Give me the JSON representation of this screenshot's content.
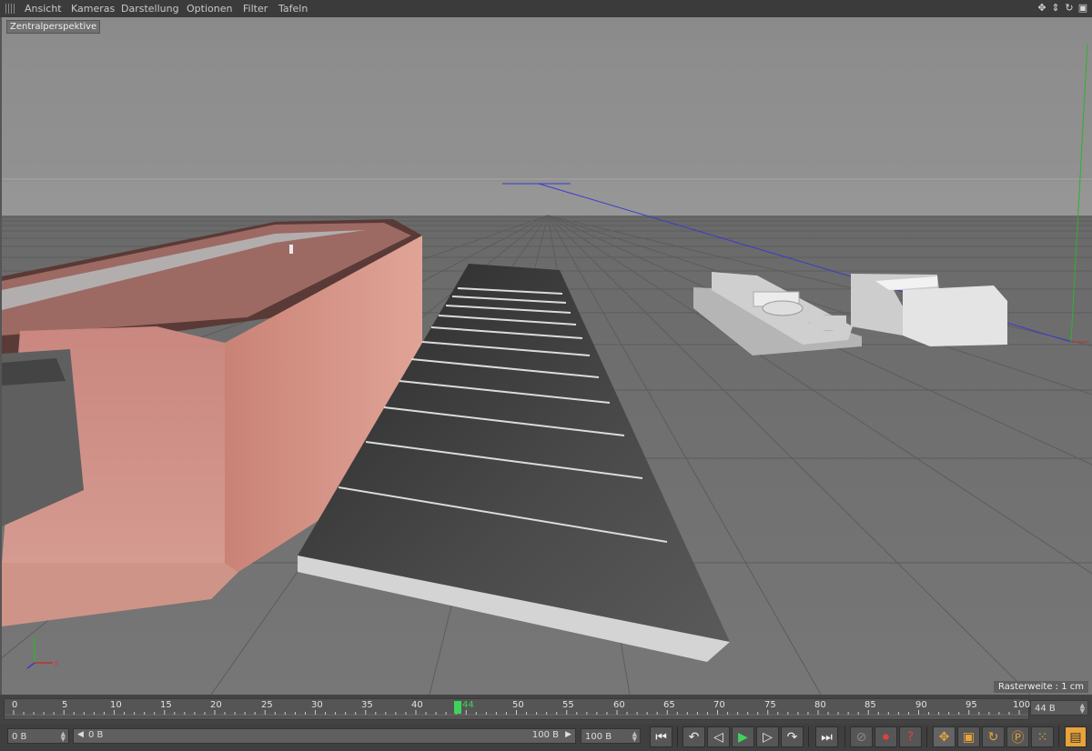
{
  "menu": {
    "items": [
      "Ansicht",
      "Kameras",
      "Darstellung",
      "Optionen",
      "Filter",
      "Tafeln"
    ]
  },
  "nav_icons": [
    "move-view-icon",
    "dolly-view-icon",
    "rotate-view-icon",
    "maximize-view-icon"
  ],
  "viewport": {
    "title": "Zentralperspektive",
    "raster_label": "Rasterweite : 1 cm",
    "axis_labels": {
      "y": "Y",
      "x": "X"
    }
  },
  "timeline": {
    "ticks": [
      "0",
      "5",
      "10",
      "15",
      "20",
      "25",
      "30",
      "35",
      "40",
      "44",
      "50",
      "55",
      "60",
      "65",
      "70",
      "75",
      "80",
      "85",
      "90",
      "95",
      "100"
    ],
    "current_frame": "44",
    "current_frame_field": "44 B"
  },
  "controls": {
    "start_field": "0 B",
    "range_start": "0 B",
    "range_end": "100 B",
    "end_field": "100 B",
    "colors": {
      "accent": "#e8a33a",
      "play": "#3fd35b"
    }
  }
}
